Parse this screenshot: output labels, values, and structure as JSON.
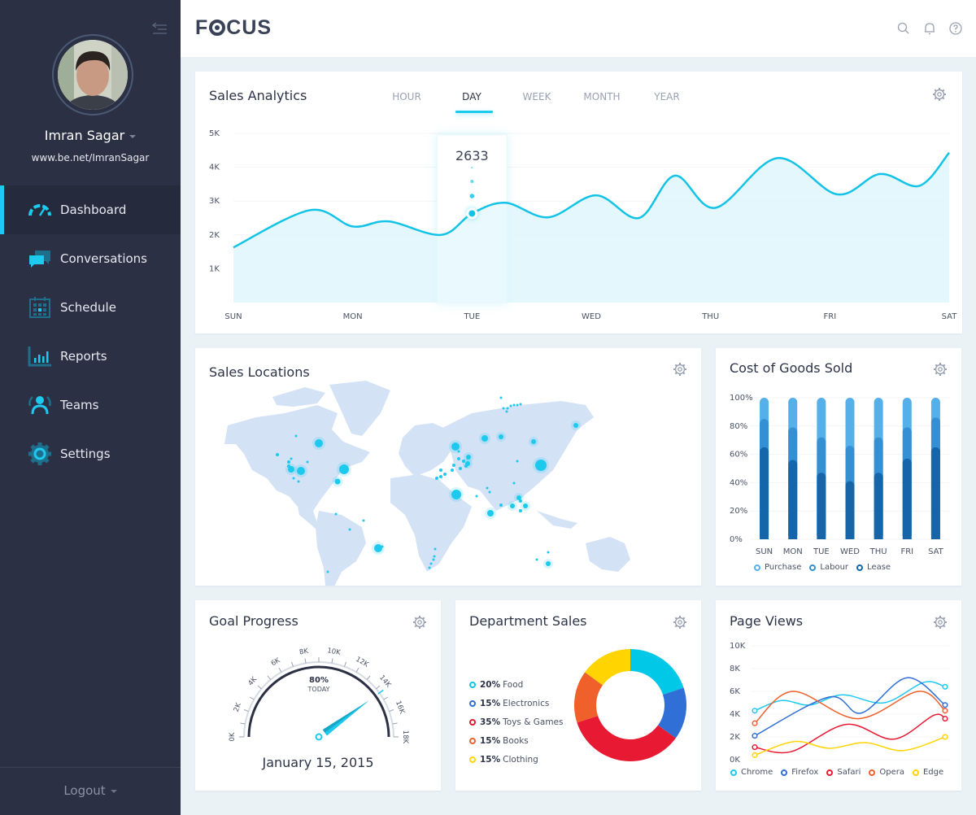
{
  "sidebar": {
    "user_name": "Imran Sagar",
    "user_url": "www.be.net/ImranSagar",
    "nav": [
      {
        "label": "Dashboard",
        "icon": "speedometer-icon",
        "active": true
      },
      {
        "label": "Conversations",
        "icon": "chat-bubbles-icon",
        "active": false
      },
      {
        "label": "Schedule",
        "icon": "calendar-icon",
        "active": false
      },
      {
        "label": "Reports",
        "icon": "bar-chart-icon",
        "active": false
      },
      {
        "label": "Teams",
        "icon": "users-icon",
        "active": false
      },
      {
        "label": "Settings",
        "icon": "gear-icon",
        "active": false
      }
    ],
    "logout_label": "Logout"
  },
  "header": {
    "logo": "FOCUS",
    "icons": [
      "search-icon",
      "bell-icon",
      "help-icon"
    ]
  },
  "colors": {
    "accent": "#1ec9ee",
    "sidebar_bg": "#2b3044",
    "page_bg": "#eaf2f6"
  },
  "sales_analytics": {
    "title": "Sales Analytics",
    "tabs": [
      "HOUR",
      "DAY",
      "WEEK",
      "MONTH",
      "YEAR"
    ],
    "active_tab": "DAY",
    "tooltip_value": "2633",
    "tooltip_day": "TUE"
  },
  "sales_locations": {
    "title": "Sales Locations"
  },
  "cost_of_goods": {
    "title": "Cost of Goods Sold"
  },
  "goal_progress": {
    "title": "Goal Progress",
    "percent_label": "80%",
    "sub_label": "TODAY",
    "date": "January 15, 2015",
    "value_fraction": 0.8
  },
  "department_sales": {
    "title": "Department Sales"
  },
  "page_views": {
    "title": "Page Views"
  },
  "chart_data": [
    {
      "id": "sales",
      "type": "area",
      "title": "Sales Analytics",
      "categories": [
        "SUN",
        "MON",
        "TUE",
        "WED",
        "THU",
        "FRI",
        "SAT"
      ],
      "yticks": [
        "1K",
        "2K",
        "3K",
        "4K",
        "5K"
      ],
      "ylim": [
        0,
        5000
      ],
      "series": [
        {
          "name": "Sales",
          "x": [
            0,
            0.64,
            1.0,
            1.3,
            1.74,
            2.0,
            2.28,
            2.64,
            3.04,
            3.4,
            3.7,
            4.04,
            4.56,
            5.06,
            5.42,
            5.75,
            6.0
          ],
          "values": [
            1630,
            2730,
            2250,
            2400,
            2000,
            2633,
            2950,
            2520,
            3170,
            2500,
            3750,
            2800,
            4270,
            3200,
            3800,
            3450,
            4430
          ]
        }
      ],
      "highlight": {
        "x": 2.0,
        "value": 2633,
        "label": "2633"
      }
    },
    {
      "id": "cogs",
      "type": "bar",
      "stacked": true,
      "title": "Cost of Goods Sold",
      "categories": [
        "SUN",
        "MON",
        "TUE",
        "WED",
        "THU",
        "FRI",
        "SAT"
      ],
      "yticks": [
        "0%",
        "20%",
        "40%",
        "60%",
        "80%",
        "100%"
      ],
      "ylim": [
        0,
        100
      ],
      "series": [
        {
          "name": "Lease",
          "color": "#1565a8",
          "values": [
            65,
            56,
            47,
            41,
            47,
            57,
            65
          ]
        },
        {
          "name": "Labour",
          "color": "#3590d3",
          "values": [
            20,
            23,
            25,
            25,
            25,
            22,
            21
          ]
        },
        {
          "name": "Purchase",
          "color": "#55b0ea",
          "values": [
            15,
            21,
            28,
            34,
            28,
            21,
            14
          ]
        }
      ],
      "legend": [
        {
          "name": "Purchase",
          "color": "#55b0ea"
        },
        {
          "name": "Labour",
          "color": "#3590d3"
        },
        {
          "name": "Lease",
          "color": "#1565a8"
        }
      ]
    },
    {
      "id": "gauge",
      "type": "gauge",
      "title": "Goal Progress",
      "ticks": [
        "0K",
        "2K",
        "4K",
        "6K",
        "8K",
        "10K",
        "12K",
        "14K",
        "16K",
        "18K"
      ],
      "range": [
        0,
        18000
      ],
      "value_fraction": 0.8
    },
    {
      "id": "dept",
      "type": "pie",
      "donut": true,
      "title": "Department Sales",
      "slices": [
        {
          "label": "Food",
          "pct_label": "20%",
          "value": 20,
          "color": "#00c8e6"
        },
        {
          "label": "Electronics",
          "pct_label": "15%",
          "value": 15,
          "color": "#2f6fd6"
        },
        {
          "label": "Toys & Games",
          "pct_label": "35%",
          "value": 35,
          "color": "#e81a33"
        },
        {
          "label": "Books",
          "pct_label": "15%",
          "value": 15,
          "color": "#f0602a"
        },
        {
          "label": "Clothing",
          "pct_label": "15%",
          "value": 15,
          "color": "#ffd400"
        }
      ]
    },
    {
      "id": "pageviews",
      "type": "line",
      "title": "Page Views",
      "yticks": [
        "0K",
        "2K",
        "4K",
        "6K",
        "8K",
        "10K"
      ],
      "ylim": [
        0,
        10000
      ],
      "series": [
        {
          "name": "Chrome",
          "color": "#1ec9ee",
          "x": [
            0,
            0.14,
            0.29,
            0.46,
            0.68,
            0.89,
            1.0
          ],
          "values": [
            4300,
            5200,
            4800,
            5700,
            5000,
            6800,
            6400
          ]
        },
        {
          "name": "Firefox",
          "color": "#2f6fd6",
          "x": [
            0,
            0.39,
            0.56,
            0.8,
            1.0
          ],
          "values": [
            2100,
            5500,
            4100,
            7200,
            4800
          ]
        },
        {
          "name": "Safari",
          "color": "#e81a33",
          "x": [
            0,
            0.19,
            0.48,
            0.73,
            0.94,
            1.0
          ],
          "values": [
            1100,
            700,
            3100,
            1800,
            3900,
            3600
          ]
        },
        {
          "name": "Opera",
          "color": "#f0602a",
          "x": [
            0,
            0.2,
            0.54,
            0.86,
            1.0
          ],
          "values": [
            3200,
            6000,
            3600,
            6000,
            4300
          ]
        },
        {
          "name": "Edge",
          "color": "#ffd400",
          "x": [
            0,
            0.21,
            0.39,
            0.58,
            0.78,
            1.0
          ],
          "values": [
            400,
            1600,
            1000,
            1500,
            800,
            2000
          ]
        }
      ]
    }
  ]
}
